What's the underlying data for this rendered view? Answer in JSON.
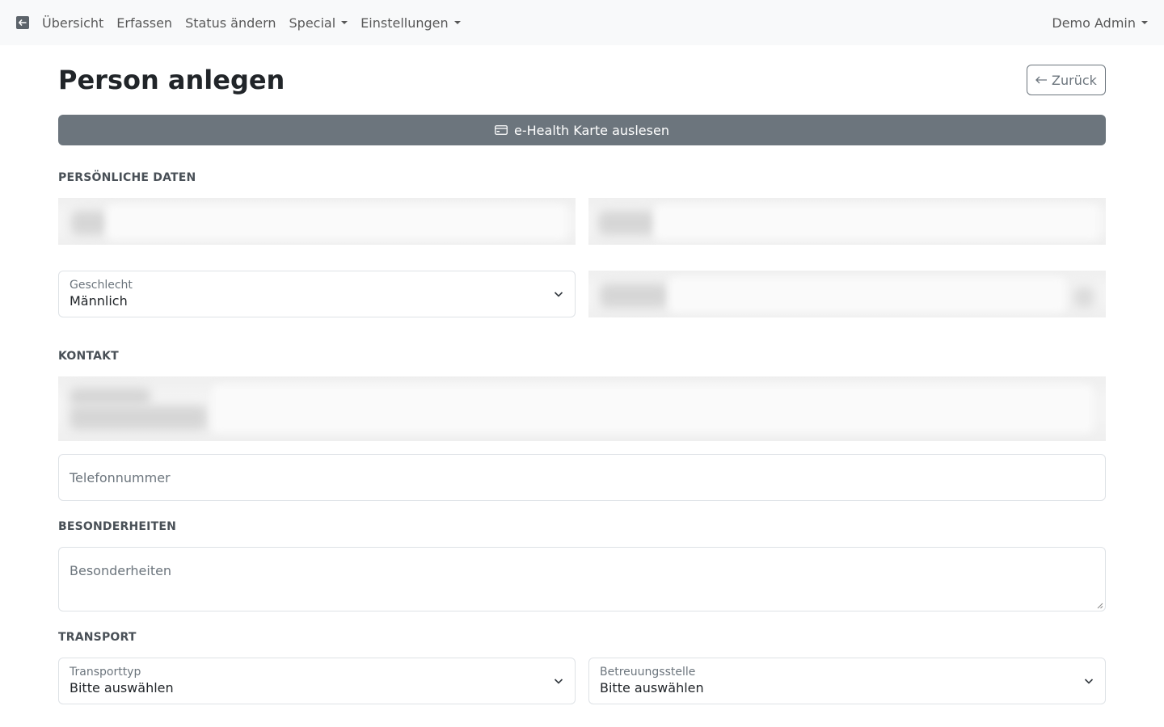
{
  "nav": {
    "brand_icon": "arrow-left-square-icon",
    "items": [
      {
        "label": "Übersicht"
      },
      {
        "label": "Erfassen"
      },
      {
        "label": "Status ändern"
      },
      {
        "label": "Special"
      },
      {
        "label": "Einstellungen"
      }
    ],
    "user": "Demo Admin"
  },
  "page": {
    "title": "Person anlegen",
    "back_label": "Zurück",
    "ehealth_label": "e-Health Karte auslesen",
    "ehealth_icon": "credit-card-icon"
  },
  "sections": {
    "personal": "PERSÖNLICHE DATEN",
    "contact": "KONTAKT",
    "special": "BESONDERHEITEN",
    "transport": "TRANSPORT"
  },
  "fields": {
    "gender": {
      "label": "Geschlecht",
      "value": "Männlich"
    },
    "phone": {
      "placeholder": "Telefonnummer"
    },
    "notes": {
      "placeholder": "Besonderheiten"
    },
    "transport_type": {
      "label": "Transporttyp",
      "value": "Bitte auswählen"
    },
    "care_point": {
      "label": "Betreuungsstelle",
      "value": "Bitte auswählen"
    }
  },
  "colors": {
    "navbar_bg": "#f8f9fa",
    "secondary": "#6c757d",
    "border": "#dee2e6"
  }
}
